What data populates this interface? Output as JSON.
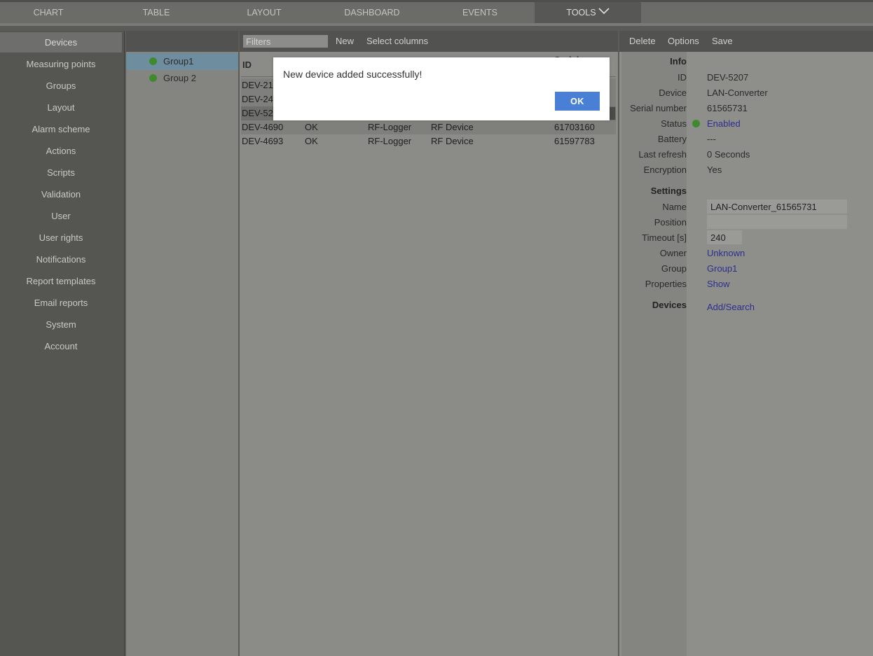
{
  "topnav": {
    "tabs": [
      {
        "label": "CHART"
      },
      {
        "label": "TABLE"
      },
      {
        "label": "LAYOUT"
      },
      {
        "label": "DASHBOARD"
      },
      {
        "label": "EVENTS"
      },
      {
        "label": "TOOLS",
        "active": true
      }
    ]
  },
  "sidebar": {
    "items": [
      {
        "label": "Devices",
        "active": true
      },
      {
        "label": "Measuring points"
      },
      {
        "label": "Groups"
      },
      {
        "label": "Layout"
      },
      {
        "label": "Alarm scheme"
      },
      {
        "label": "Actions"
      },
      {
        "label": "Scripts"
      },
      {
        "label": "Validation"
      },
      {
        "label": "User"
      },
      {
        "label": "User rights"
      },
      {
        "label": "Notifications"
      },
      {
        "label": "Report templates"
      },
      {
        "label": "Email reports"
      },
      {
        "label": "System"
      },
      {
        "label": "Account"
      }
    ]
  },
  "groups": {
    "items": [
      {
        "label": "Group1",
        "active": true,
        "status_color": "#3f8a2e"
      },
      {
        "label": "Group 2",
        "status_color": "#3f8a2e"
      }
    ]
  },
  "devices": {
    "toolbar": {
      "filters_placeholder": "Filters",
      "new_label": "New",
      "select_columns_label": "Select columns"
    },
    "columns": {
      "id": "ID",
      "serial": "Serial"
    },
    "rows": [
      {
        "id": "DEV-214",
        "status": "",
        "device": "",
        "type": "",
        "serial": ""
      },
      {
        "id": "DEV-249",
        "status": "",
        "device": "",
        "type": "",
        "serial": ""
      },
      {
        "id": "DEV-520",
        "status": "",
        "device": "",
        "type": "",
        "serial": "",
        "selected": true
      },
      {
        "id": "DEV-4690",
        "status": "OK",
        "device": "RF-Logger",
        "type": "RF Device",
        "serial": "61703160"
      },
      {
        "id": "DEV-4693",
        "status": "OK",
        "device": "RF-Logger",
        "type": "RF Device",
        "serial": "61597783"
      }
    ]
  },
  "detail": {
    "toolbar": {
      "delete_label": "Delete",
      "options_label": "Options",
      "save_label": "Save"
    },
    "info": {
      "section": "Info",
      "id_label": "ID",
      "id_value": "DEV-5207",
      "device_label": "Device",
      "device_value": "LAN-Converter",
      "serial_label": "Serial number",
      "serial_value": "61565731",
      "status_label": "Status",
      "status_value": "Enabled",
      "status_color": "#3f8a2e",
      "battery_label": "Battery",
      "battery_value": "---",
      "refresh_label": "Last refresh",
      "refresh_value": "0 Seconds",
      "encryption_label": "Encryption",
      "encryption_value": "Yes"
    },
    "settings": {
      "section": "Settings",
      "name_label": "Name",
      "name_value": "LAN-Converter_61565731",
      "position_label": "Position",
      "position_value": "",
      "timeout_label": "Timeout [s]",
      "timeout_value": "240",
      "owner_label": "Owner",
      "owner_value": "Unknown",
      "group_label": "Group",
      "group_value": "Group1",
      "properties_label": "Properties",
      "properties_value": "Show"
    },
    "devices": {
      "section": "Devices",
      "link": "Add/Search"
    }
  },
  "dialog": {
    "message": "New device added successfully!",
    "ok_label": "OK"
  }
}
